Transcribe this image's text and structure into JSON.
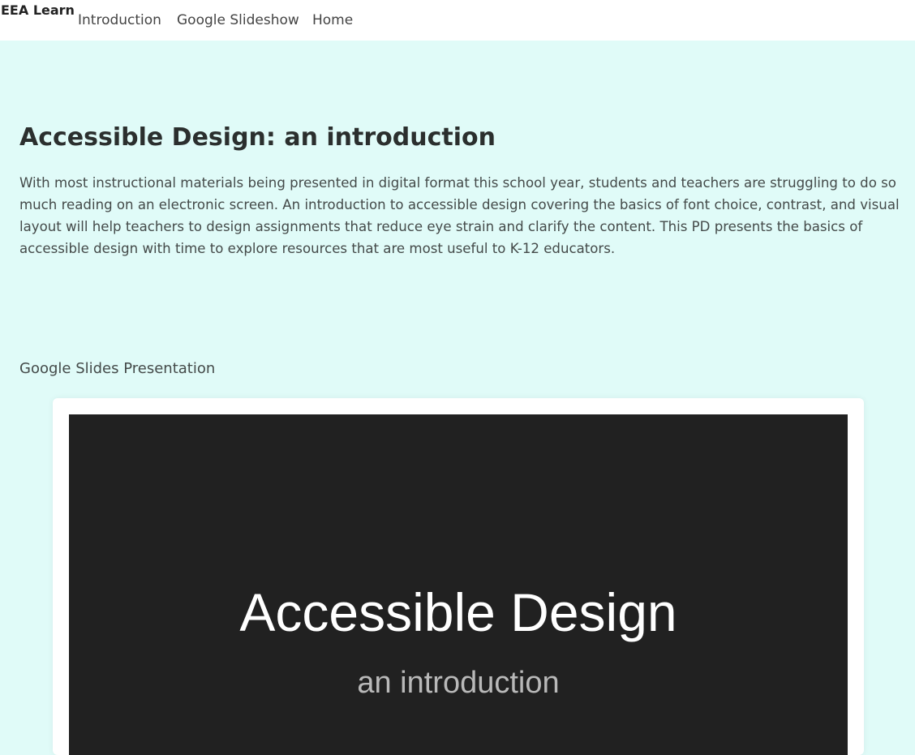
{
  "nav": {
    "brand": "EEA Learn",
    "links": [
      "Introduction",
      "Google Slideshow",
      "Home"
    ]
  },
  "main": {
    "title": "Accessible Design: an introduction",
    "description": "With most instructional materials being presented in digital format this school year, students and teachers are struggling to do so much reading on an electronic screen. An introduction to accessible design covering the basics of font choice, contrast, and visual layout will help teachers to design assignments that reduce eye strain and clarify the content. This PD presents the basics of accessible design with time to explore resources that are most useful to K-12 educators.",
    "section_label": "Google Slides Presentation"
  },
  "slide": {
    "title": "Accessible Design",
    "subtitle": "an introduction"
  },
  "colors": {
    "page_background": "#e0fbf8",
    "navbar_background": "#ffffff",
    "slide_background": "#212121",
    "slide_title": "#ffffff",
    "slide_subtitle": "#b9b9b9"
  }
}
